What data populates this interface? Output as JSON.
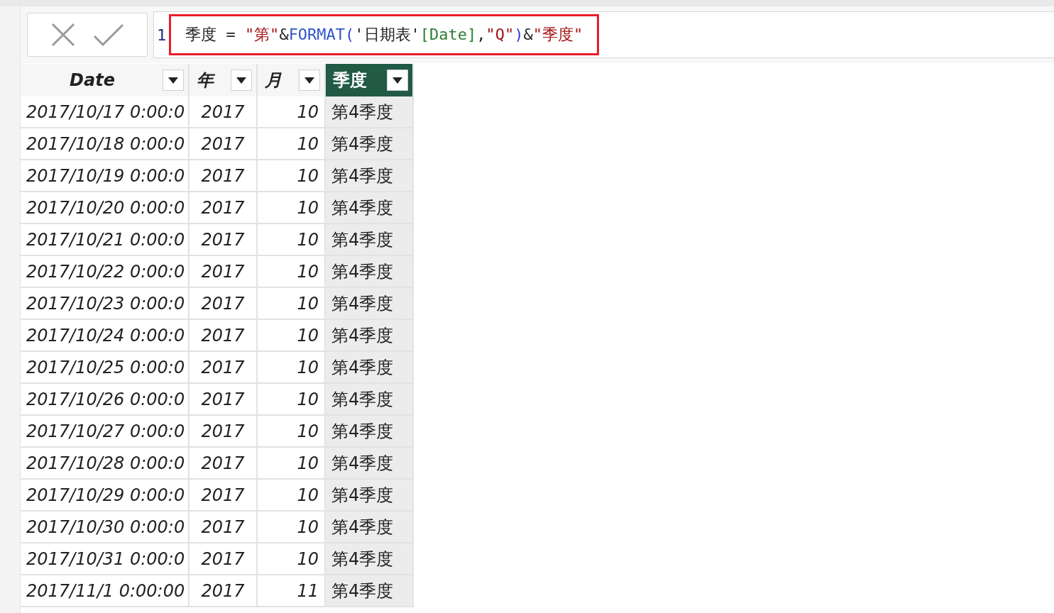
{
  "formula_bar": {
    "line_number": "1",
    "highlighted": true,
    "tokens": [
      {
        "kind": "name",
        "text": "季度"
      },
      {
        "kind": "operator",
        "text": "="
      },
      {
        "kind": "string",
        "text": "\"第\""
      },
      {
        "kind": "operator",
        "text": "&"
      },
      {
        "kind": "function",
        "text": "FORMAT"
      },
      {
        "kind": "paren",
        "text": "("
      },
      {
        "kind": "table",
        "text": "'日期表'"
      },
      {
        "kind": "column",
        "text": "[Date]"
      },
      {
        "kind": "operator",
        "text": ","
      },
      {
        "kind": "string",
        "text": "\"Q\""
      },
      {
        "kind": "paren",
        "text": ")"
      },
      {
        "kind": "operator",
        "text": "&"
      },
      {
        "kind": "string",
        "text": "\"季度\""
      }
    ]
  },
  "table": {
    "columns": [
      {
        "label": "Date",
        "selected": false
      },
      {
        "label": "年",
        "selected": false
      },
      {
        "label": "月",
        "selected": false
      },
      {
        "label": "季度",
        "selected": true
      }
    ],
    "rows": [
      [
        "2017/10/17 0:00:0",
        "2017",
        "10",
        "第4季度"
      ],
      [
        "2017/10/18 0:00:0",
        "2017",
        "10",
        "第4季度"
      ],
      [
        "2017/10/19 0:00:0",
        "2017",
        "10",
        "第4季度"
      ],
      [
        "2017/10/20 0:00:0",
        "2017",
        "10",
        "第4季度"
      ],
      [
        "2017/10/21 0:00:0",
        "2017",
        "10",
        "第4季度"
      ],
      [
        "2017/10/22 0:00:0",
        "2017",
        "10",
        "第4季度"
      ],
      [
        "2017/10/23 0:00:0",
        "2017",
        "10",
        "第4季度"
      ],
      [
        "2017/10/24 0:00:0",
        "2017",
        "10",
        "第4季度"
      ],
      [
        "2017/10/25 0:00:0",
        "2017",
        "10",
        "第4季度"
      ],
      [
        "2017/10/26 0:00:0",
        "2017",
        "10",
        "第4季度"
      ],
      [
        "2017/10/27 0:00:0",
        "2017",
        "10",
        "第4季度"
      ],
      [
        "2017/10/28 0:00:0",
        "2017",
        "10",
        "第4季度"
      ],
      [
        "2017/10/29 0:00:0",
        "2017",
        "10",
        "第4季度"
      ],
      [
        "2017/10/30 0:00:0",
        "2017",
        "10",
        "第4季度"
      ],
      [
        "2017/10/31 0:00:0",
        "2017",
        "10",
        "第4季度"
      ],
      [
        "2017/11/1 0:00:00",
        "2017",
        "11",
        "第4季度"
      ]
    ]
  }
}
